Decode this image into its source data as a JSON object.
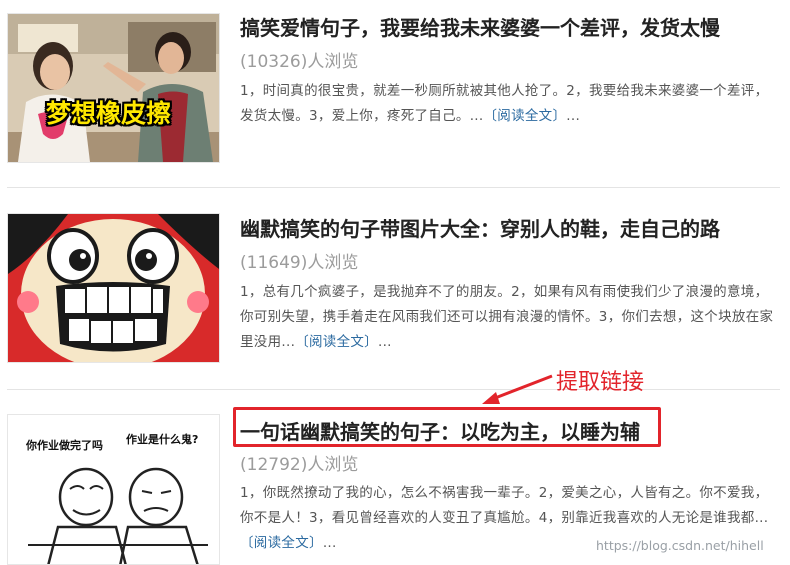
{
  "articles": [
    {
      "title": "搞笑爱情句子，我要给我未来婆婆一个差评，发货太慢",
      "views": "(10326)人浏览",
      "summary": "1，时间真的很宝贵，就差一秒厕所就被其他人抢了。2，我要给我未来婆婆一个差评，发货太慢。3，爱上你，疼死了自己。...",
      "read_more": "〔阅读全文〕",
      "ellipsis": "...",
      "thumb_caption": "梦想橡皮擦"
    },
    {
      "title": "幽默搞笑的句子带图片大全：穿别人的鞋，走自己的路",
      "views": "(11649)人浏览",
      "summary": "1，总有几个疯婆子，是我抛弃不了的朋友。2，如果有风有雨使我们少了浪漫的意境，你可别失望，携手着走在风雨我们还可以拥有浪漫的情怀。3，你们去想，这个块放在家里没用...",
      "read_more": "〔阅读全文〕",
      "ellipsis": "..."
    },
    {
      "title": "一句话幽默搞笑的句子：以吃为主，以睡为辅",
      "views": "(12792)人浏览",
      "summary": "1，你既然撩动了我的心，怎么不祸害我一辈子。2，爱美之心，人皆有之。你不爱我，你不是人！3，看见曾经喜欢的人变丑了真尴尬。4，别靠近我喜欢的人无论是谁我都...",
      "read_more": "〔阅读全文〕",
      "ellipsis": "...",
      "thumb_bubble_left": "你作业做完了吗",
      "thumb_bubble_right": "作业是什么鬼?"
    }
  ],
  "annotation": {
    "text": "提取链接",
    "color": "#e2242b"
  },
  "watermark": "https://blog.csdn.net/hihell",
  "colors": {
    "title": "#222222",
    "views": "#9b9b9b",
    "summary": "#555555",
    "link": "#2b6aa0",
    "highlight": "#e2242b"
  }
}
